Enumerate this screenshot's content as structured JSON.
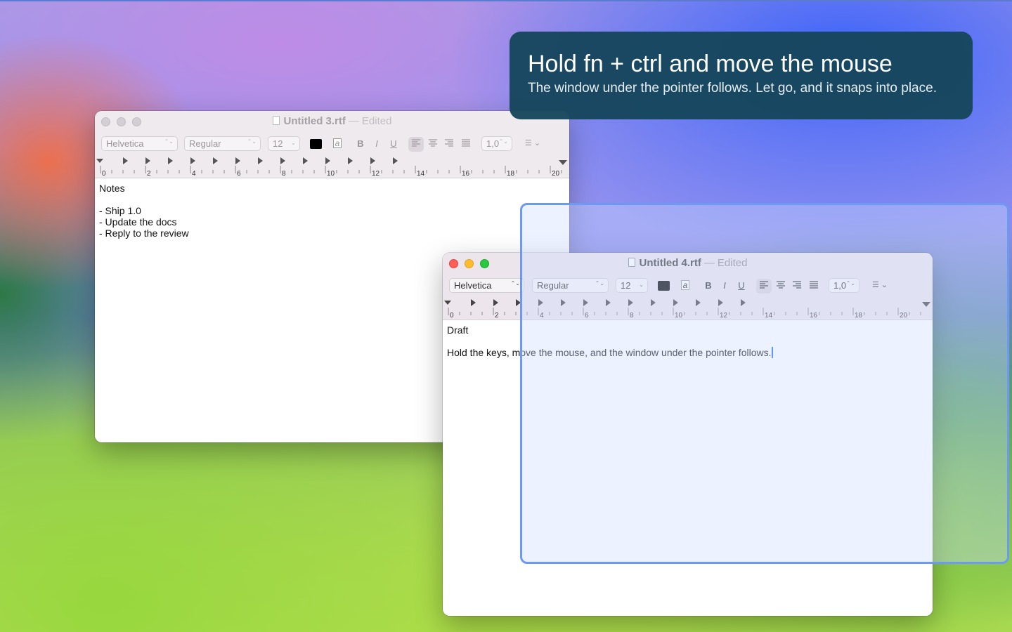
{
  "hint": {
    "title": "Hold fn + ctrl and move the mouse",
    "subtitle": "The window under the pointer follows. Let go, and it snaps into place."
  },
  "colors": {
    "hint_background": "#16465c",
    "snap_outline": "#6d9af0",
    "close": "#ff5f57",
    "minimize": "#febc2e",
    "zoom": "#28c840",
    "caret": "#1a6cf0"
  },
  "toolbar": {
    "font_family": "Helvetica",
    "font_style": "Regular",
    "font_size": "12",
    "bold_label": "B",
    "italic_label": "I",
    "underline_label": "U",
    "line_spacing": "1,0",
    "popup_arrows": "⌃⌄",
    "size_chevron": "⌄",
    "list_glyph": "☰",
    "list_chevron": "⌄",
    "highlight_glyph": "a"
  },
  "ruler": {
    "labels": [
      "0",
      "2",
      "4",
      "6",
      "8",
      "10",
      "12",
      "14",
      "16",
      "18",
      "20"
    ]
  },
  "windows": [
    {
      "title": "Untitled 3.rtf",
      "separator": "—",
      "status": "Edited",
      "active": false,
      "lines": [
        "Notes",
        "",
        "- Ship 1.0",
        "- Update the docs",
        "- Reply to the review"
      ]
    },
    {
      "title": "Untitled 4.rtf",
      "separator": "—",
      "status": "Edited",
      "active": true,
      "lines": [
        "Draft",
        "",
        "Hold the keys, move the mouse, and the window under the pointer follows."
      ]
    }
  ]
}
